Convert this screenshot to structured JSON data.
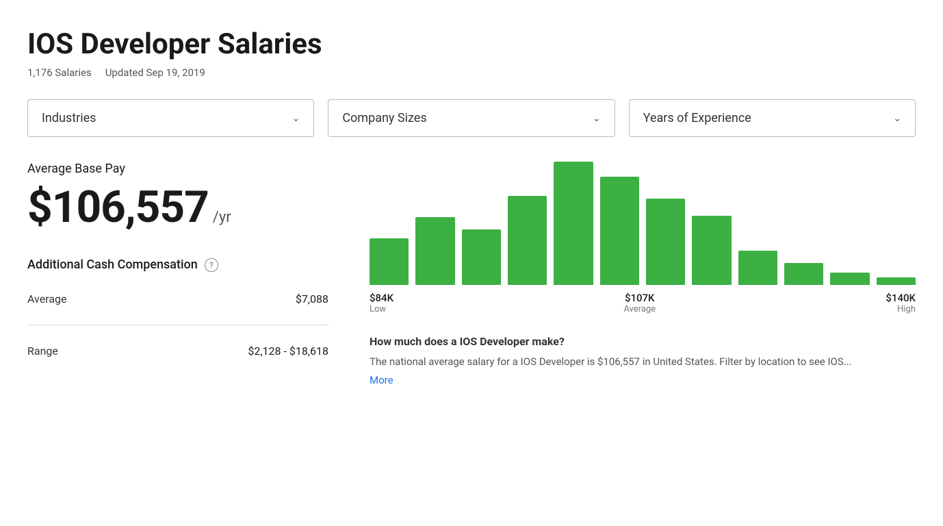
{
  "page": {
    "title": "IOS Developer Salaries",
    "salary_count": "1,176 Salaries",
    "updated_date": "Updated Sep 19, 2019"
  },
  "filters": [
    {
      "id": "industries",
      "label": "Industries"
    },
    {
      "id": "company-sizes",
      "label": "Company Sizes"
    },
    {
      "id": "years-of-experience",
      "label": "Years of Experience"
    }
  ],
  "salary": {
    "avg_base_label": "Average Base Pay",
    "amount": "$106,557",
    "period": "/yr"
  },
  "cash_comp": {
    "title": "Additional Cash Compensation",
    "help_tooltip": "?",
    "rows": [
      {
        "label": "Average",
        "value": "$7,088"
      },
      {
        "label": "Range",
        "value": "$2,128 - $18,618"
      }
    ]
  },
  "chart": {
    "bars": [
      {
        "height_pct": 38
      },
      {
        "height_pct": 55
      },
      {
        "height_pct": 45
      },
      {
        "height_pct": 72
      },
      {
        "height_pct": 100
      },
      {
        "height_pct": 88
      },
      {
        "height_pct": 70
      },
      {
        "height_pct": 56
      },
      {
        "height_pct": 28
      },
      {
        "height_pct": 18
      },
      {
        "height_pct": 10
      },
      {
        "height_pct": 6
      }
    ],
    "labels": [
      {
        "value": "$84K",
        "desc": "Low",
        "position": "left"
      },
      {
        "value": "$107K",
        "desc": "Average",
        "position": "center"
      },
      {
        "value": "$140K",
        "desc": "High",
        "position": "right"
      }
    ]
  },
  "description": {
    "title": "How much does a IOS Developer make?",
    "text": "The national average salary for a IOS Developer is $106,557 in United States. Filter by location to see IOS...",
    "more_label": "More"
  }
}
